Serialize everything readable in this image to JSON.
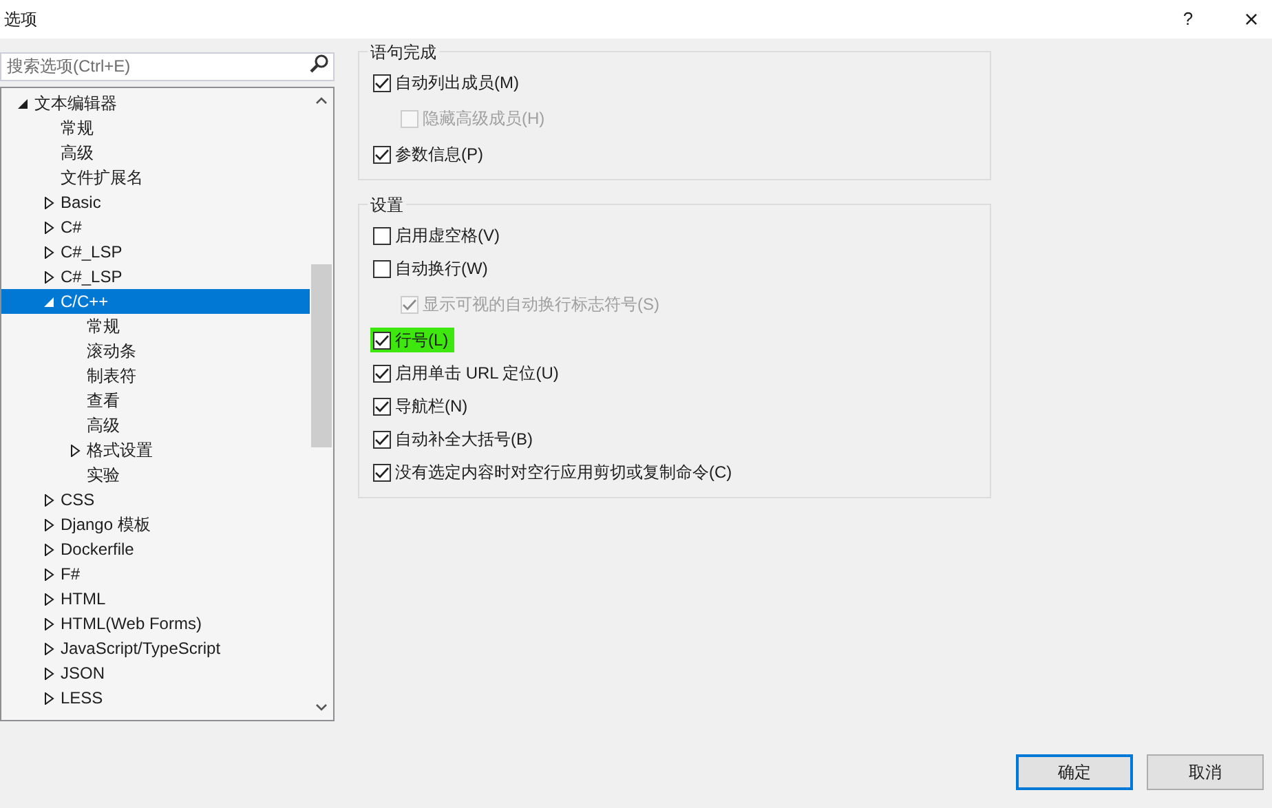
{
  "window": {
    "title": "选项",
    "help": "?",
    "close": "×"
  },
  "search": {
    "placeholder": "搜索选项(Ctrl+E)"
  },
  "tree": [
    {
      "label": "文本编辑器",
      "selected": false,
      "expanded": true,
      "children": [
        {
          "label": "常规",
          "selected": false
        },
        {
          "label": "高级",
          "selected": false
        },
        {
          "label": "文件扩展名",
          "selected": false
        },
        {
          "label": "Basic",
          "selected": false,
          "expanded": false
        },
        {
          "label": "C#",
          "selected": false,
          "expanded": false
        },
        {
          "label": "C#_LSP",
          "selected": false,
          "expanded": false
        },
        {
          "label": "C#_LSP",
          "selected": false,
          "expanded": false
        },
        {
          "label": "C/C++",
          "selected": true,
          "expanded": true,
          "children": [
            {
              "label": "常规",
              "selected": false
            },
            {
              "label": "滚动条",
              "selected": false
            },
            {
              "label": "制表符",
              "selected": false
            },
            {
              "label": "查看",
              "selected": false
            },
            {
              "label": "高级",
              "selected": false
            },
            {
              "label": "格式设置",
              "selected": false,
              "expanded": false
            },
            {
              "label": "实验",
              "selected": false
            }
          ]
        },
        {
          "label": "CSS",
          "selected": false,
          "expanded": false
        },
        {
          "label": "Django 模板",
          "selected": false,
          "expanded": false
        },
        {
          "label": "Dockerfile",
          "selected": false,
          "expanded": false
        },
        {
          "label": "F#",
          "selected": false,
          "expanded": false
        },
        {
          "label": "HTML",
          "selected": false,
          "expanded": false
        },
        {
          "label": "HTML(Web Forms)",
          "selected": false,
          "expanded": false
        },
        {
          "label": "JavaScript/TypeScript",
          "selected": false,
          "expanded": false
        },
        {
          "label": "JSON",
          "selected": false,
          "expanded": false
        },
        {
          "label": "LESS",
          "selected": false,
          "expanded": false
        }
      ]
    }
  ],
  "groups": [
    {
      "title": "语句完成",
      "options": [
        {
          "label": "自动列出成员(M)",
          "checked": true,
          "disabled": false,
          "children": [
            {
              "label": "隐藏高级成员(H)",
              "checked": false,
              "disabled": true
            }
          ]
        },
        {
          "label": "参数信息(P)",
          "checked": true,
          "disabled": false
        }
      ]
    },
    {
      "title": "设置",
      "options": [
        {
          "label": "启用虚空格(V)",
          "checked": false,
          "disabled": false
        },
        {
          "label": "自动换行(W)",
          "checked": false,
          "disabled": false,
          "children": [
            {
              "label": "显示可视的自动换行标志符号(S)",
              "checked": true,
              "disabled": true
            }
          ]
        },
        {
          "label": "行号(L)",
          "checked": true,
          "disabled": false,
          "highlighted": true
        },
        {
          "label": "启用单击 URL 定位(U)",
          "checked": true,
          "disabled": false
        },
        {
          "label": "导航栏(N)",
          "checked": true,
          "disabled": false
        },
        {
          "label": "自动补全大括号(B)",
          "checked": true,
          "disabled": false
        },
        {
          "label": "没有选定内容时对空行应用剪切或复制命令(C)",
          "checked": true,
          "disabled": false
        }
      ]
    }
  ],
  "buttons": [
    {
      "label": "确定",
      "kind": "primary"
    },
    {
      "label": "取消",
      "kind": "secondary"
    }
  ]
}
